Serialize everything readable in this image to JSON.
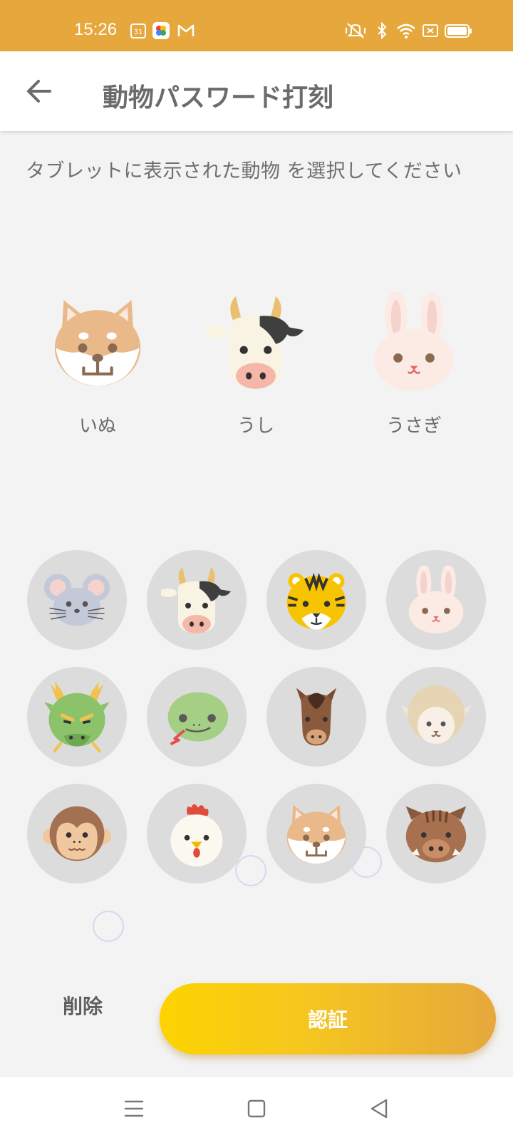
{
  "status_bar": {
    "time": "15:26",
    "bg_color": "#e6a83c",
    "notification_icons": [
      "calendar-31-icon",
      "photos-icon",
      "gmail-icon"
    ],
    "calendar_day": "31",
    "right_icons": [
      "vibrate-icon",
      "bluetooth-icon",
      "wifi-icon",
      "data-off-icon",
      "battery-icon"
    ]
  },
  "app_bar": {
    "title": "動物パスワード打刻",
    "back_icon": "arrow-left-icon"
  },
  "instruction": "タブレットに表示された動物 を選択してください",
  "selected": [
    {
      "id": "dog",
      "label": "いぬ"
    },
    {
      "id": "cow",
      "label": "うし"
    },
    {
      "id": "rabbit",
      "label": "うさぎ"
    }
  ],
  "grid": [
    {
      "id": "mouse",
      "icon": "mouse-face-icon"
    },
    {
      "id": "cow",
      "icon": "cow-face-icon"
    },
    {
      "id": "tiger",
      "icon": "tiger-face-icon"
    },
    {
      "id": "rabbit",
      "icon": "rabbit-face-icon"
    },
    {
      "id": "dragon",
      "icon": "dragon-face-icon"
    },
    {
      "id": "snake",
      "icon": "snake-face-icon"
    },
    {
      "id": "horse",
      "icon": "horse-face-icon"
    },
    {
      "id": "sheep",
      "icon": "sheep-face-icon"
    },
    {
      "id": "monkey",
      "icon": "monkey-face-icon"
    },
    {
      "id": "rooster",
      "icon": "rooster-face-icon"
    },
    {
      "id": "dog",
      "icon": "dog-face-icon"
    },
    {
      "id": "boar",
      "icon": "boar-face-icon"
    }
  ],
  "buttons": {
    "delete": "削除",
    "authenticate": "認証"
  },
  "colors": {
    "accent": "#e6a83c",
    "button_gradient_start": "#fcd300",
    "button_gradient_end": "#e6a83c",
    "grid_circle": "#dcdcdc"
  },
  "nav_bar": {
    "icons": [
      "menu-icon",
      "home-square-icon",
      "back-triangle-icon"
    ]
  }
}
